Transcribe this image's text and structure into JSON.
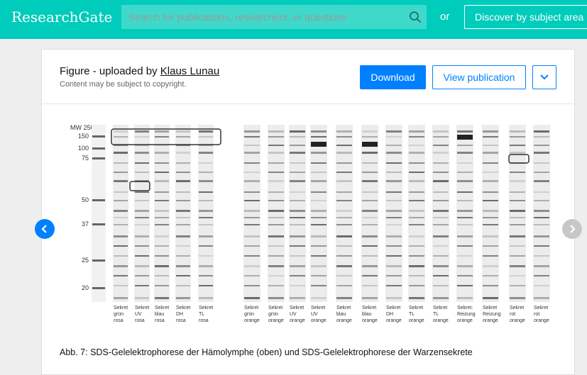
{
  "brand": {
    "logo": "ResearchGate"
  },
  "search": {
    "placeholder": "Search for publications, researchers, or questions",
    "icon": "search-icon"
  },
  "header": {
    "or_label": "or",
    "discover_label": "Discover by subject area"
  },
  "figure": {
    "title_prefix": "Figure - uploaded by ",
    "uploader": "Klaus Lunau",
    "copyright_note": "Content may be subject to copyright.",
    "download_label": "Download",
    "view_label": "View publication",
    "caption": "Abb. 7: SDS-Gelelektrophorese der Hämolymphe (oben) und SDS-Gelelektrophorese der Warzensekrete",
    "mw_header": "MW 250",
    "mw_markers": [
      "150",
      "100",
      "75",
      "50",
      "37",
      "25",
      "20"
    ],
    "left_gel_lanes": [
      [
        "Sekret",
        "grün",
        "rosa"
      ],
      [
        "Sekret",
        "UV",
        "rosa"
      ],
      [
        "Sekret",
        "blau",
        "rosa"
      ],
      [
        "Sekret",
        "DH",
        "rosa"
      ],
      [
        "Sekret",
        "TL",
        "rosa"
      ]
    ],
    "right_gel_lanes": [
      [
        "Sekret",
        "grün",
        "orange"
      ],
      [
        "Sekret",
        "grün",
        "orange"
      ],
      [
        "Sekret",
        "UV",
        "orange"
      ],
      [
        "Sekret",
        "UV",
        "orange"
      ],
      [
        "Sekret",
        "blau",
        "orange"
      ],
      [
        "Sekret",
        "blau",
        "orange"
      ],
      [
        "Sekret",
        "DH",
        "orange"
      ],
      [
        "Sekret",
        "TL",
        "orange"
      ],
      [
        "Sekret",
        "TL",
        "orange"
      ],
      [
        "Sekret:",
        "Reizung",
        "orange"
      ],
      [
        "Sekret",
        "Reizung",
        "orange"
      ],
      [
        "Sekret",
        "rot",
        "orange"
      ],
      [
        "Sekret",
        "rot",
        "orange"
      ]
    ]
  },
  "colors": {
    "brand": "#00ccbb",
    "primary": "#0080ff"
  }
}
